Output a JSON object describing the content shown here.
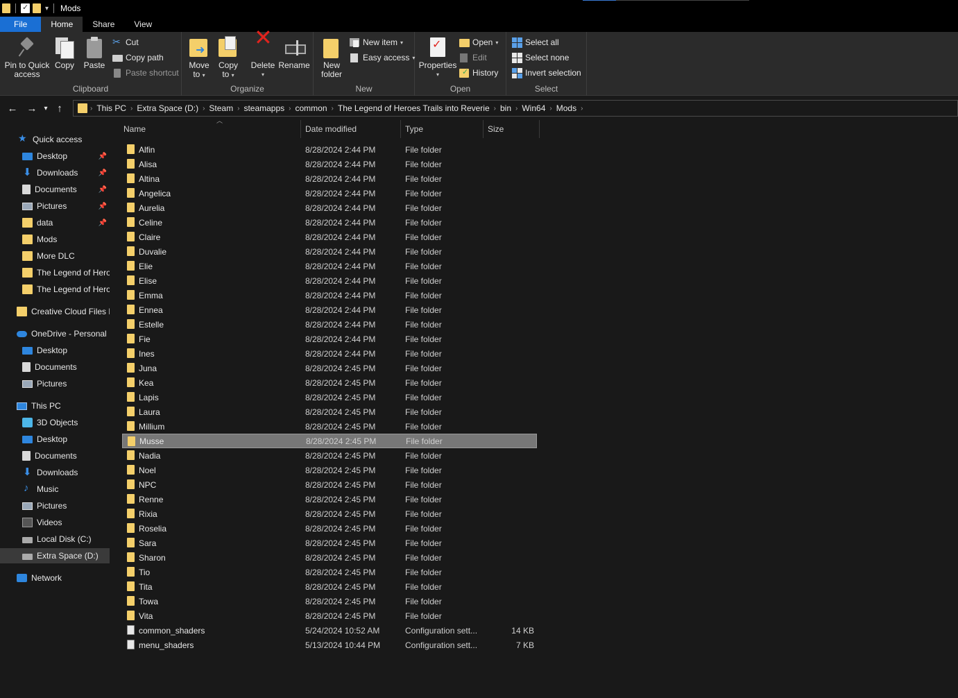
{
  "window": {
    "title": "Mods"
  },
  "tabs": [
    "File",
    "Home",
    "Share",
    "View"
  ],
  "ribbon": {
    "clipboard": {
      "label": "Clipboard",
      "pin_line1": "Pin to Quick",
      "pin_line2": "access",
      "copy": "Copy",
      "paste": "Paste",
      "cut": "Cut",
      "copy_path": "Copy path",
      "paste_shortcut": "Paste shortcut"
    },
    "organize": {
      "label": "Organize",
      "move_line1": "Move",
      "move_line2": "to",
      "copy_line1": "Copy",
      "copy_line2": "to",
      "delete": "Delete",
      "rename": "Rename"
    },
    "new": {
      "label": "New",
      "new_folder_line1": "New",
      "new_folder_line2": "folder",
      "new_item": "New item",
      "easy_access": "Easy access"
    },
    "open": {
      "label": "Open",
      "properties": "Properties",
      "open": "Open",
      "edit": "Edit",
      "history": "History"
    },
    "select": {
      "label": "Select",
      "select_all": "Select all",
      "select_none": "Select none",
      "invert": "Invert selection"
    }
  },
  "breadcrumbs": [
    "This PC",
    "Extra Space (D:)",
    "Steam",
    "steamapps",
    "common",
    "The Legend of Heroes Trails into Reverie",
    "bin",
    "Win64",
    "Mods"
  ],
  "sidebar": {
    "quick_access": "Quick access",
    "quick_items": [
      {
        "label": "Desktop",
        "icon": "desktop-icon",
        "pinned": true
      },
      {
        "label": "Downloads",
        "icon": "downloads-icon",
        "pinned": true
      },
      {
        "label": "Documents",
        "icon": "documents-icon",
        "pinned": true
      },
      {
        "label": "Pictures",
        "icon": "pictures-icon",
        "pinned": true
      },
      {
        "label": "data",
        "icon": "folder-icon",
        "pinned": true
      },
      {
        "label": "Mods",
        "icon": "folder-icon",
        "pinned": false
      },
      {
        "label": "More DLC",
        "icon": "folder-icon",
        "pinned": false
      },
      {
        "label": "The Legend of Hero",
        "icon": "folder-icon",
        "pinned": false
      },
      {
        "label": "The Legend of Hero",
        "icon": "folder-icon",
        "pinned": false
      }
    ],
    "creative_cloud": "Creative Cloud Files P",
    "onedrive": "OneDrive - Personal",
    "onedrive_items": [
      "Desktop",
      "Documents",
      "Pictures"
    ],
    "this_pc": "This PC",
    "pc_items": [
      "3D Objects",
      "Desktop",
      "Documents",
      "Downloads",
      "Music",
      "Pictures",
      "Videos",
      "Local Disk (C:)",
      "Extra Space (D:)"
    ],
    "network": "Network"
  },
  "columns": {
    "name": "Name",
    "date": "Date modified",
    "type": "Type",
    "size": "Size"
  },
  "files": [
    {
      "name": "Alfin",
      "date": "8/28/2024 2:44 PM",
      "type": "File folder",
      "size": ""
    },
    {
      "name": "Alisa",
      "date": "8/28/2024 2:44 PM",
      "type": "File folder",
      "size": ""
    },
    {
      "name": "Altina",
      "date": "8/28/2024 2:44 PM",
      "type": "File folder",
      "size": ""
    },
    {
      "name": "Angelica",
      "date": "8/28/2024 2:44 PM",
      "type": "File folder",
      "size": ""
    },
    {
      "name": "Aurelia",
      "date": "8/28/2024 2:44 PM",
      "type": "File folder",
      "size": ""
    },
    {
      "name": "Celine",
      "date": "8/28/2024 2:44 PM",
      "type": "File folder",
      "size": ""
    },
    {
      "name": "Claire",
      "date": "8/28/2024 2:44 PM",
      "type": "File folder",
      "size": ""
    },
    {
      "name": "Duvalie",
      "date": "8/28/2024 2:44 PM",
      "type": "File folder",
      "size": ""
    },
    {
      "name": "Elie",
      "date": "8/28/2024 2:44 PM",
      "type": "File folder",
      "size": ""
    },
    {
      "name": "Elise",
      "date": "8/28/2024 2:44 PM",
      "type": "File folder",
      "size": ""
    },
    {
      "name": "Emma",
      "date": "8/28/2024 2:44 PM",
      "type": "File folder",
      "size": ""
    },
    {
      "name": "Ennea",
      "date": "8/28/2024 2:44 PM",
      "type": "File folder",
      "size": ""
    },
    {
      "name": "Estelle",
      "date": "8/28/2024 2:44 PM",
      "type": "File folder",
      "size": ""
    },
    {
      "name": "Fie",
      "date": "8/28/2024 2:44 PM",
      "type": "File folder",
      "size": ""
    },
    {
      "name": "Ines",
      "date": "8/28/2024 2:44 PM",
      "type": "File folder",
      "size": ""
    },
    {
      "name": "Juna",
      "date": "8/28/2024 2:45 PM",
      "type": "File folder",
      "size": ""
    },
    {
      "name": "Kea",
      "date": "8/28/2024 2:45 PM",
      "type": "File folder",
      "size": ""
    },
    {
      "name": "Lapis",
      "date": "8/28/2024 2:45 PM",
      "type": "File folder",
      "size": ""
    },
    {
      "name": "Laura",
      "date": "8/28/2024 2:45 PM",
      "type": "File folder",
      "size": ""
    },
    {
      "name": "Millium",
      "date": "8/28/2024 2:45 PM",
      "type": "File folder",
      "size": ""
    },
    {
      "name": "Musse",
      "date": "8/28/2024 2:45 PM",
      "type": "File folder",
      "size": "",
      "selected": true
    },
    {
      "name": "Nadia",
      "date": "8/28/2024 2:45 PM",
      "type": "File folder",
      "size": ""
    },
    {
      "name": "Noel",
      "date": "8/28/2024 2:45 PM",
      "type": "File folder",
      "size": ""
    },
    {
      "name": "NPC",
      "date": "8/28/2024 2:45 PM",
      "type": "File folder",
      "size": ""
    },
    {
      "name": "Renne",
      "date": "8/28/2024 2:45 PM",
      "type": "File folder",
      "size": ""
    },
    {
      "name": "Rixia",
      "date": "8/28/2024 2:45 PM",
      "type": "File folder",
      "size": ""
    },
    {
      "name": "Roselia",
      "date": "8/28/2024 2:45 PM",
      "type": "File folder",
      "size": ""
    },
    {
      "name": "Sara",
      "date": "8/28/2024 2:45 PM",
      "type": "File folder",
      "size": ""
    },
    {
      "name": "Sharon",
      "date": "8/28/2024 2:45 PM",
      "type": "File folder",
      "size": ""
    },
    {
      "name": "Tio",
      "date": "8/28/2024 2:45 PM",
      "type": "File folder",
      "size": ""
    },
    {
      "name": "Tita",
      "date": "8/28/2024 2:45 PM",
      "type": "File folder",
      "size": ""
    },
    {
      "name": "Towa",
      "date": "8/28/2024 2:45 PM",
      "type": "File folder",
      "size": ""
    },
    {
      "name": "Vita",
      "date": "8/28/2024 2:45 PM",
      "type": "File folder",
      "size": ""
    },
    {
      "name": "common_shaders",
      "date": "5/24/2024 10:52 AM",
      "type": "Configuration sett...",
      "size": "14 KB",
      "kind": "config"
    },
    {
      "name": "menu_shaders",
      "date": "5/13/2024 10:44 PM",
      "type": "Configuration sett...",
      "size": "7 KB",
      "kind": "config"
    }
  ],
  "colors": {
    "accent": "#1a6fd4",
    "folder": "#f4cf6a",
    "background": "#191919",
    "ribbon": "#2b2b2b",
    "selection": "#777777"
  }
}
